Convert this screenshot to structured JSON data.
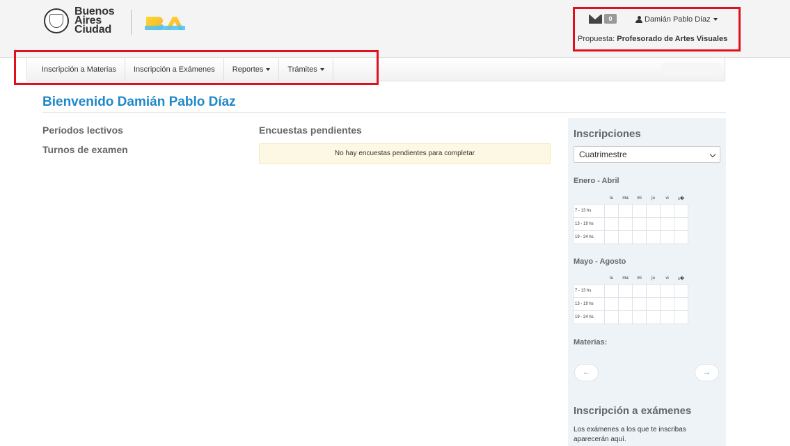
{
  "header": {
    "logo_lines": [
      "Buenos",
      "Aires",
      "Ciudad"
    ],
    "mail_count": "0",
    "user_name": "Damián Pablo Díaz",
    "propuesta_label": "Propuesta:",
    "propuesta_value": "Profesorado de Artes Visuales"
  },
  "nav": {
    "items": [
      {
        "label": "Inscripción a Materias"
      },
      {
        "label": "Inscripción a Exámenes"
      },
      {
        "label": "Reportes"
      },
      {
        "label": "Trámites"
      }
    ]
  },
  "main": {
    "welcome": "Bienvenido Damián Pablo Díaz",
    "periodos": "Períodos lectivos",
    "turnos": "Turnos de examen",
    "encuestas_title": "Encuestas pendientes",
    "encuestas_message": "No hay encuestas pendientes para completar"
  },
  "panel": {
    "title": "Inscripciones",
    "select_value": "Cuatrimestre",
    "days": [
      "lu",
      "ma",
      "mi",
      "ju",
      "vi",
      "s�"
    ],
    "periods": [
      {
        "title": "Enero - Abril",
        "rows": [
          "7 - 13 hs",
          "13 - 19 hs",
          "19 - 24 hs"
        ]
      },
      {
        "title": "Mayo - Agosto",
        "rows": [
          "7 - 13 hs",
          "13 - 19 hs",
          "19 - 24 hs"
        ]
      }
    ],
    "materias_label": "Materias:",
    "prev_arrow": "←",
    "next_arrow": "→",
    "exam_title": "Inscripción a exámenes",
    "exam_text": "Los exámenes a los que te inscribas aparecerán aquí."
  },
  "colors": {
    "accent": "#1e88c8",
    "highlight_border": "#e0101c",
    "alert_bg": "#fcf8e3",
    "panel_bg": "#eef3f7"
  }
}
